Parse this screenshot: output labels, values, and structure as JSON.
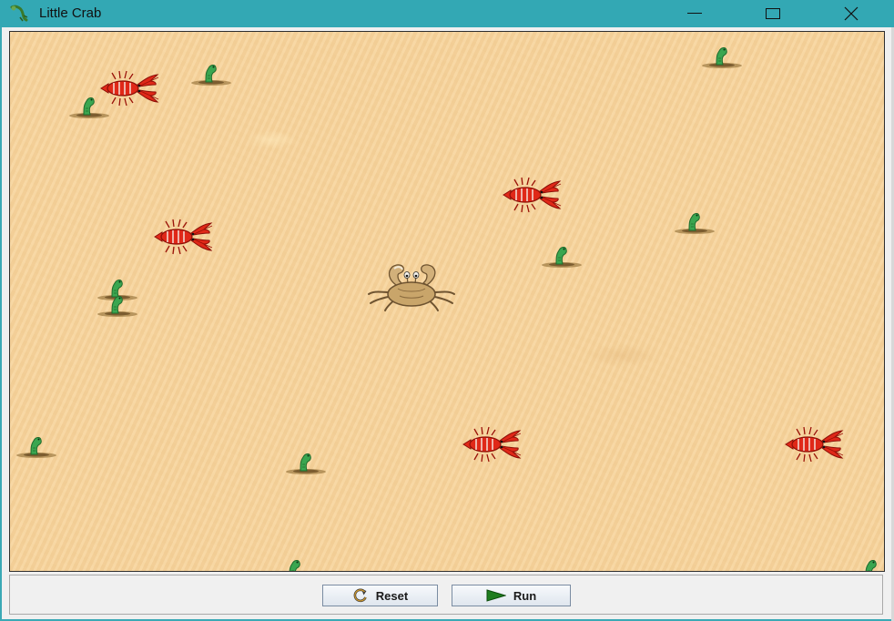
{
  "window": {
    "title": "Little Crab"
  },
  "controls": {
    "reset_label": "Reset",
    "run_label": "Run"
  },
  "colors": {
    "titlebar": "#33a8b4",
    "sand": "#f6d39c",
    "lobster": "#e02818",
    "worm": "#3aa650",
    "crab": "#c9a56a"
  },
  "world": {
    "actors": {
      "crab": 1,
      "lobsters": 5,
      "worms": 13
    }
  }
}
